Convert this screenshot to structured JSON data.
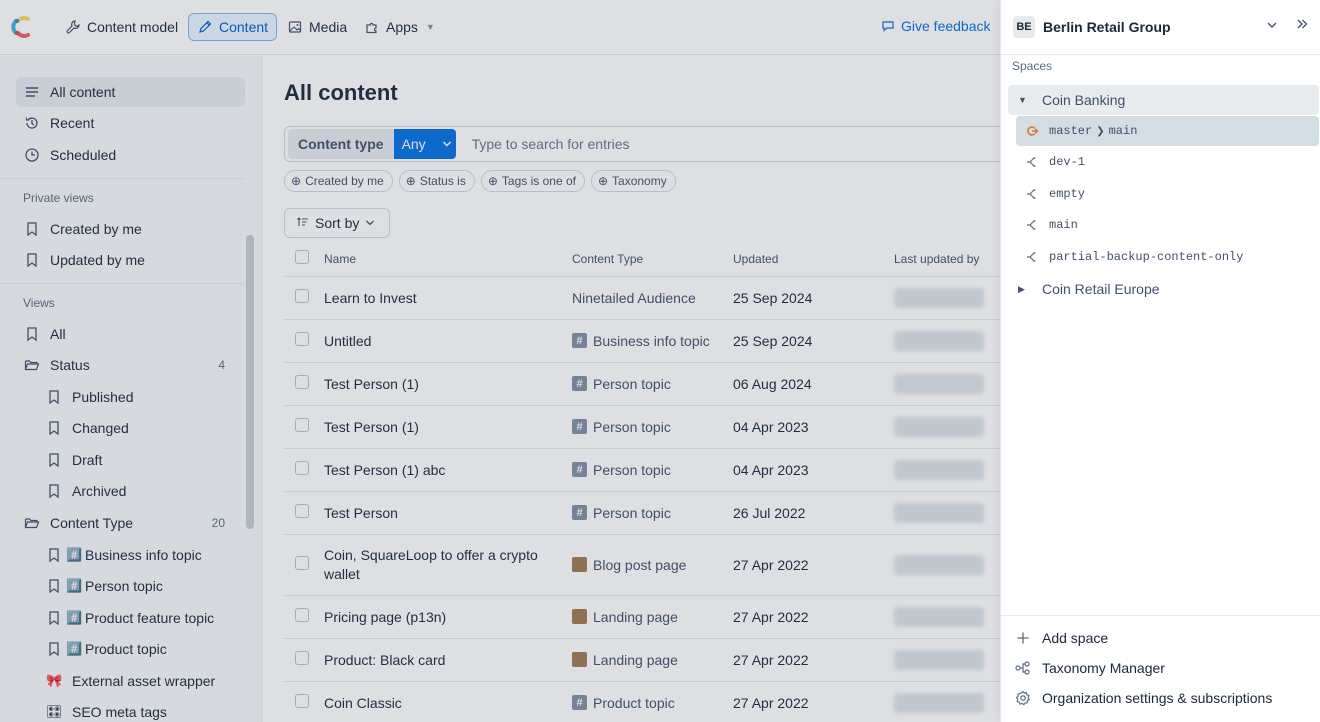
{
  "topnav": {
    "items": [
      {
        "label": "Content model",
        "icon": "wrench-icon"
      },
      {
        "label": "Content",
        "icon": "pen-icon",
        "active": true
      },
      {
        "label": "Media",
        "icon": "image-icon"
      },
      {
        "label": "Apps",
        "icon": "puzzle-icon"
      }
    ],
    "feedback": "Give feedback"
  },
  "sidebar": {
    "top_items": [
      {
        "label": "All content",
        "icon": "list-icon"
      },
      {
        "label": "Recent",
        "icon": "history-icon"
      },
      {
        "label": "Scheduled",
        "icon": "clock-icon"
      }
    ],
    "private_views_title": "Private views",
    "private_views": [
      "Created by me",
      "Updated by me"
    ],
    "views_title": "Views",
    "views_all": "All",
    "status_folder": {
      "label": "Status",
      "count": "4"
    },
    "status_items": [
      "Published",
      "Changed",
      "Draft",
      "Archived"
    ],
    "ctype_folder": {
      "label": "Content Type",
      "count": "20"
    },
    "ctype_items": [
      {
        "label": "Business info topic",
        "emoji": "#️⃣"
      },
      {
        "label": "Person topic",
        "emoji": "#️⃣"
      },
      {
        "label": "Product feature topic",
        "emoji": "#️⃣"
      },
      {
        "label": "Product topic",
        "emoji": "#️⃣"
      },
      {
        "label": "External asset wrapper",
        "emoji": "🎀"
      },
      {
        "label": "SEO meta tags",
        "emoji": "🎛"
      }
    ]
  },
  "main": {
    "title": "All content",
    "content_type_label": "Content type",
    "content_type_value": "Any",
    "search_placeholder": "Type to search for entries",
    "filters": [
      "Created by me",
      "Status is",
      "Tags is one of",
      "Taxonomy"
    ],
    "sort_label": "Sort by",
    "columns": [
      "Name",
      "Content Type",
      "Updated",
      "Last updated by"
    ],
    "rows": [
      {
        "name": "Learn to Invest",
        "ctype": "Ninetailed Audience",
        "tag": "none",
        "updated": "25 Sep 2024"
      },
      {
        "name": "Untitled",
        "ctype": "Business info topic",
        "tag": "hash",
        "updated": "25 Sep 2024"
      },
      {
        "name": "Test Person (1)",
        "ctype": "Person topic",
        "tag": "hash",
        "updated": "06 Aug 2024"
      },
      {
        "name": "Test Person (1)",
        "ctype": "Person topic",
        "tag": "hash",
        "updated": "04 Apr 2023"
      },
      {
        "name": "Test Person (1) abc",
        "ctype": "Person topic",
        "tag": "hash",
        "updated": "04 Apr 2023"
      },
      {
        "name": "Test Person",
        "ctype": "Person topic",
        "tag": "hash",
        "updated": "26 Jul 2022"
      },
      {
        "name": "Coin, SquareLoop to offer a crypto wallet",
        "ctype": "Blog post page",
        "tag": "page",
        "updated": "27 Apr 2022"
      },
      {
        "name": "Pricing page (p13n)",
        "ctype": "Landing page",
        "tag": "page",
        "updated": "27 Apr 2022"
      },
      {
        "name": "Product: Black card",
        "ctype": "Landing page",
        "tag": "page",
        "updated": "27 Apr 2022"
      },
      {
        "name": "Coin Classic",
        "ctype": "Product topic",
        "tag": "hash",
        "updated": "27 Apr 2022"
      }
    ]
  },
  "panel": {
    "org_initials": "BE",
    "org_name": "Berlin Retail Group",
    "spaces_label": "Spaces",
    "space_expanded": "Coin Banking",
    "environments": [
      {
        "alias": "master",
        "target": "main",
        "active": true
      },
      {
        "alias": "dev-1"
      },
      {
        "alias": "empty"
      },
      {
        "alias": "main"
      },
      {
        "alias": "partial-backup-content-only"
      }
    ],
    "space_collapsed": "Coin Retail Europe",
    "footer": [
      {
        "label": "Add space",
        "icon": "plus-icon"
      },
      {
        "label": "Taxonomy Manager",
        "icon": "taxonomy-icon"
      },
      {
        "label": "Organization settings & subscriptions",
        "icon": "gear-icon"
      }
    ]
  }
}
